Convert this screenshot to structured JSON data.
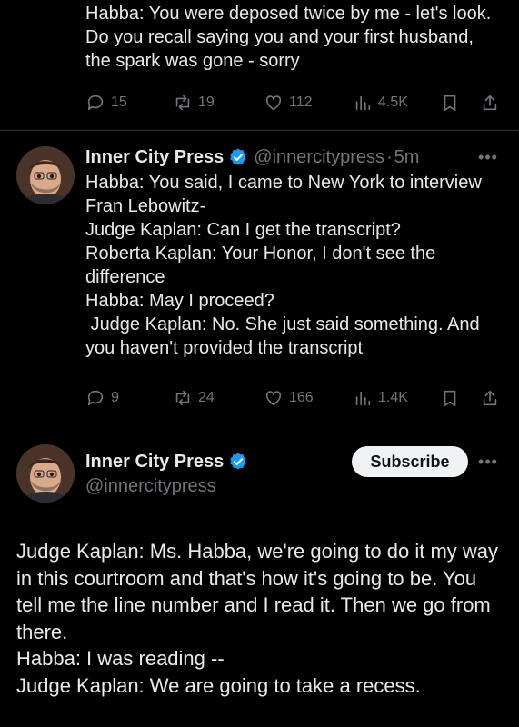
{
  "top_tweet": {
    "text": "Habba: You were deposed twice by me - let's look. Do you recall saying you and your first husband, the spark was gone - sorry",
    "stats": {
      "replies": "15",
      "reposts": "19",
      "likes": "112",
      "views": "4.5K"
    }
  },
  "tweet2": {
    "author_name": "Inner City Press",
    "handle": "@innercitypress",
    "separator": "·",
    "time": "5m",
    "more": "•••",
    "text": "Habba: You said, I came to New York to interview Fran Lebowitz-\nJudge Kaplan: Can I get the transcript?\nRoberta Kaplan: Your Honor, I don't see the difference\nHabba: May I proceed?\n Judge Kaplan: No. She just said something. And you haven't provided the transcript",
    "stats": {
      "replies": "9",
      "reposts": "24",
      "likes": "166",
      "views": "1.4K"
    }
  },
  "main_tweet": {
    "author_name": "Inner City Press",
    "handle": "@innercitypress",
    "subscribe_label": "Subscribe",
    "more": "•••",
    "text": "Judge Kaplan: Ms. Habba, we're going to do it my way in this courtroom and that's how it's going to be. You tell me the line number and I read it. Then we go from there.\nHabba: I was reading --\nJudge Kaplan: We are going to take a recess."
  },
  "colors": {
    "background": "#000000",
    "text": "#e7e9ea",
    "muted": "#71767b",
    "verified": "#1d9bf0",
    "button_bg": "#eff3f4"
  },
  "icons": [
    "reply-icon",
    "repost-icon",
    "like-icon",
    "views-icon",
    "bookmark-icon",
    "share-icon",
    "verified-badge-icon",
    "more-icon"
  ]
}
